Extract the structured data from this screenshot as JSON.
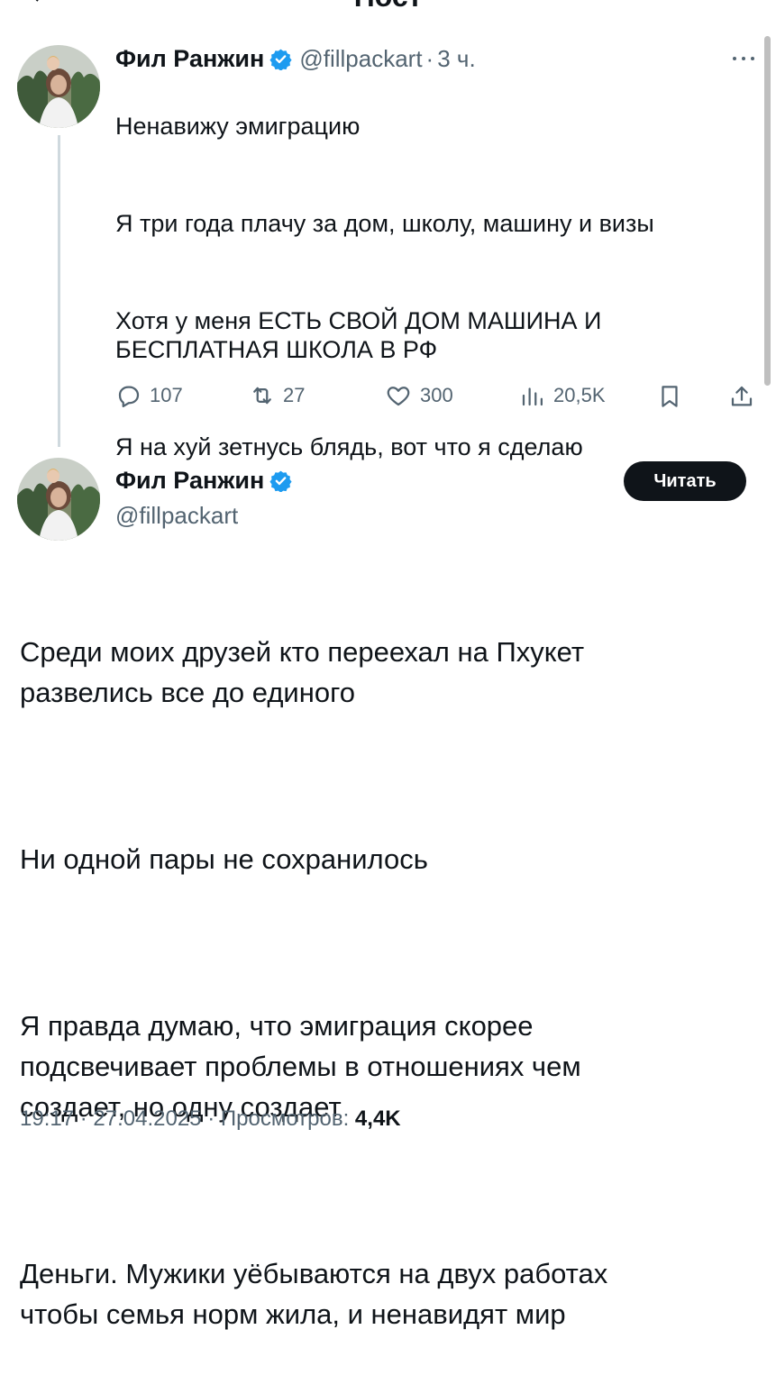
{
  "header": {
    "title": "Пост"
  },
  "thread_tweet": {
    "author_name": "Фил Ранжин",
    "handle": "@fillpackart",
    "time": "3 ч.",
    "paragraphs": [
      "Ненавижу эмиграцию",
      "Я три года плачу за дом, школу, машину и визы",
      "Хотя у меня ЕСТЬ СВОЙ ДОМ МАШИНА И БЕСПЛАТНАЯ ШКОЛА В РФ",
      "Я на хуй зетнусь блядь, вот что я сделаю"
    ],
    "actions": {
      "replies": "107",
      "reposts": "27",
      "likes": "300",
      "views": "20,5K"
    }
  },
  "main_tweet": {
    "author_name": "Фил Ранжин",
    "handle": "@fillpackart",
    "follow_label": "Читать",
    "paragraphs": [
      "Среди моих друзей кто переехал на Пхукет\nразвелись все до единого",
      "Ни одной пары не сохранилось",
      "Я правда думаю, что эмиграция скорее\nподсвечивает проблемы в отношениях чем\nсоздает, но одну создает",
      "Деньги. Мужики уёбываются на двух работах\nчтобы семья норм жила, и ненавидят мир"
    ],
    "time": "19:17",
    "date": "27.04.2025",
    "views_label": "Просмотров:",
    "views": "4,4K"
  },
  "colors": {
    "text": "#0f1419",
    "secondary": "#536471",
    "verified": "#1d9bf0",
    "thread_line": "#cfd9de"
  }
}
